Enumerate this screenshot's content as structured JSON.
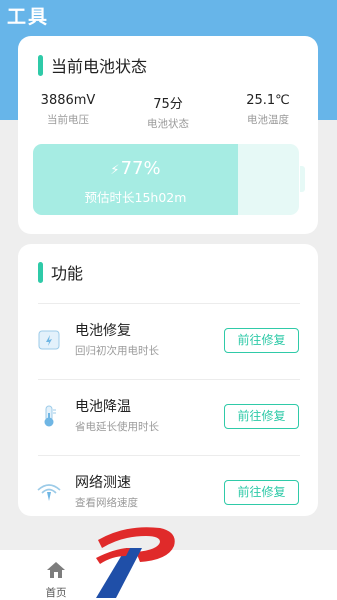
{
  "header": {
    "title": "工具"
  },
  "battery_card": {
    "heading": "当前电池状态",
    "stats": [
      {
        "value": "3886mV",
        "label": "当前电压"
      },
      {
        "value": "75分",
        "label": "电池状态"
      },
      {
        "value": "25.1℃",
        "label": "电池温度"
      }
    ],
    "battery_percent_text": "77%",
    "battery_level": 0.77,
    "remaining_text": "预估时长15h02m"
  },
  "functions_card": {
    "heading": "功能",
    "items": [
      {
        "title": "电池修复",
        "subtitle": "回归初次用电时长",
        "button": "前往修复",
        "icon": "battery-repair-icon"
      },
      {
        "title": "电池降温",
        "subtitle": "省电延长使用时长",
        "button": "前往修复",
        "icon": "thermometer-icon"
      },
      {
        "title": "网络测速",
        "subtitle": "查看网络速度",
        "button": "前往修复",
        "icon": "wifi-speed-icon"
      }
    ]
  },
  "bottom_nav": {
    "home_label": "首页",
    "home_icon": "home-icon"
  },
  "colors": {
    "accent": "#2fcaa8",
    "header": "#67b5e9",
    "battery_fill": "#a6ece3",
    "battery_bg": "#e6f9f6"
  }
}
